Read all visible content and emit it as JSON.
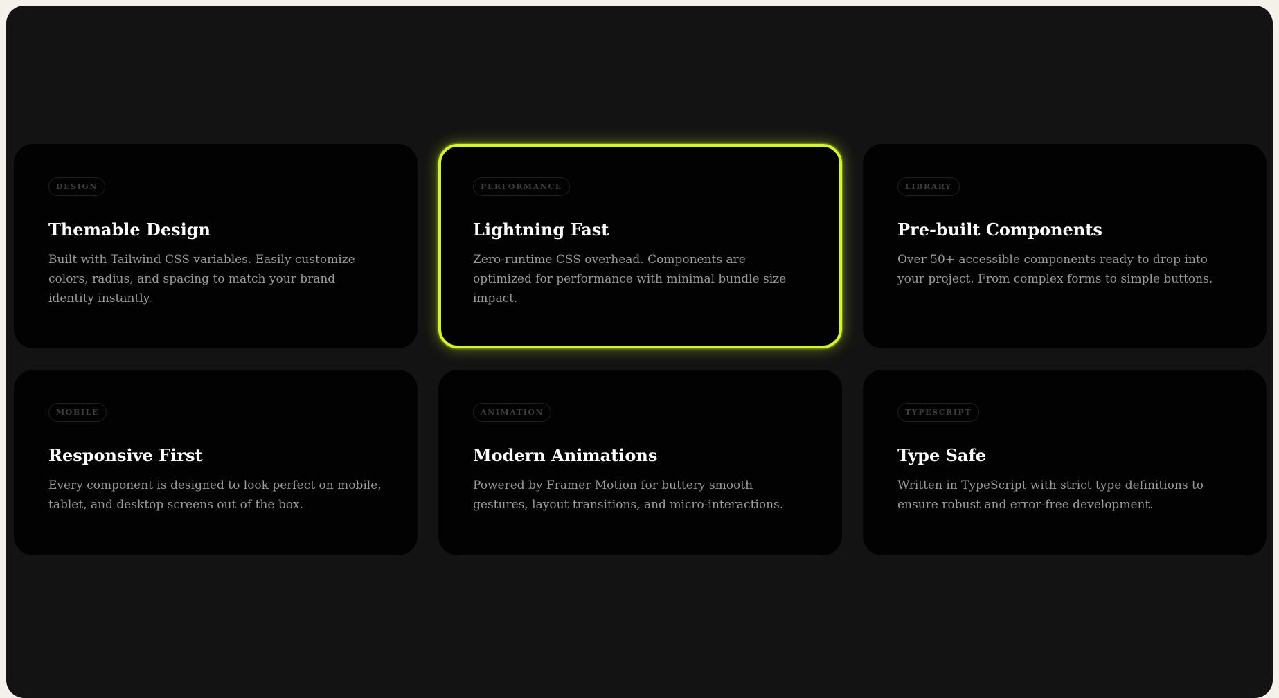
{
  "cards": [
    {
      "tag": "DESIGN",
      "title": "Themable Design",
      "description": "Built with Tailwind CSS variables. Easily customize colors, radius, and spacing to match your brand identity instantly.",
      "active": false
    },
    {
      "tag": "PERFORMANCE",
      "title": "Lightning Fast",
      "description": "Zero-runtime CSS overhead. Components are optimized for performance with minimal bundle size impact.",
      "active": true
    },
    {
      "tag": "LIBRARY",
      "title": "Pre-built Components",
      "description": "Over 50+ accessible components ready to drop into your project. From complex forms to simple buttons.",
      "active": false
    },
    {
      "tag": "MOBILE",
      "title": "Responsive First",
      "description": "Every component is designed to look perfect on mobile, tablet, and desktop screens out of the box.",
      "active": false
    },
    {
      "tag": "ANIMATION",
      "title": "Modern Animations",
      "description": "Powered by Framer Motion for buttery smooth gestures, layout transitions, and micro-interactions.",
      "active": false
    },
    {
      "tag": "TYPESCRIPT",
      "title": "Type Safe",
      "description": "Written in TypeScript with strict type definitions to ensure robust and error-free development.",
      "active": false
    }
  ],
  "colors": {
    "page_background": "#f3f1ea",
    "frame_background": "#131313",
    "card_background": "#020202",
    "accent": "#d4f52a",
    "title": "#ffffff",
    "description": "#9a9a9a",
    "tag_text": "#3e3e3e"
  }
}
